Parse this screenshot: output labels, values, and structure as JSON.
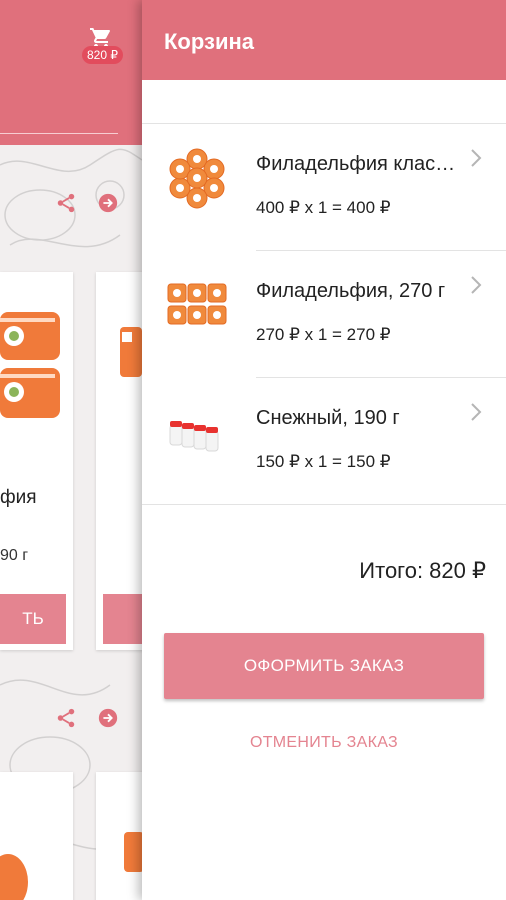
{
  "background_app": {
    "cart_badge": "820 ₽",
    "cards": [
      {
        "title_fragment": "фия",
        "weight_fragment": "90 г",
        "button_fragment": "ТЬ"
      }
    ]
  },
  "drawer": {
    "title": "Корзина",
    "items": [
      {
        "name": "Филадельфия классическая",
        "calc": "400 ₽ x 1 = 400 ₽",
        "icon": "roll-plate-icon"
      },
      {
        "name": "Филадельфия, 270 г",
        "calc": "270 ₽ x 1 = 270 ₽",
        "icon": "roll-set-icon"
      },
      {
        "name": "Снежный, 190 г",
        "calc": "150 ₽ x 1 = 150 ₽",
        "icon": "roll-row-icon"
      }
    ],
    "total": "Итого: 820 ₽",
    "checkout_label": "ОФОРМИТЬ ЗАКАЗ",
    "cancel_label": "ОТМЕНИТЬ ЗАКАЗ"
  },
  "colors": {
    "accent": "#e0707c",
    "button": "#e48490",
    "badge": "#e24c5d"
  }
}
